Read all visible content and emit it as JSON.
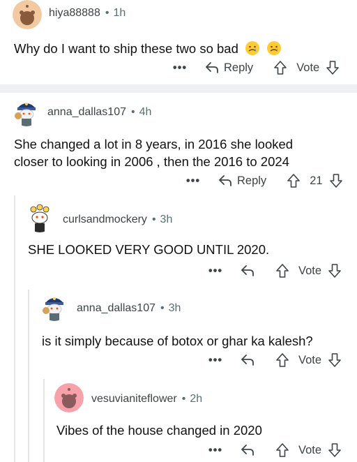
{
  "comments": [
    {
      "username": "hiya88888",
      "age": "1h",
      "text_lines": [
        "Why do I want to ship these two so bad"
      ],
      "emoji": [
        "crying-face",
        "crying-face"
      ],
      "reply_label": "Reply",
      "vote_label": "Vote",
      "avatar_color": "#f2c9a0"
    },
    {
      "username": "anna_dallas107",
      "age": "4h",
      "text_lines": [
        "She changed a lot in 8 years, in 2016 she looked",
        "closer to looking in 2006 , then the 2016 to 2024"
      ],
      "reply_label": "Reply",
      "vote_label": "21"
    },
    {
      "username": "curlsandmockery",
      "age": "3h",
      "text_lines": [
        "SHE LOOKED VERY GOOD UNTIL 2020."
      ],
      "vote_label": "Vote"
    },
    {
      "username": "anna_dallas107",
      "age": "3h",
      "text_lines": [
        "is it simply because of botox or ghar ka kalesh?"
      ],
      "vote_label": "Vote"
    },
    {
      "username": "vesuvianiteflower",
      "age": "2h",
      "text_lines": [
        "Vibes of the house changed in 2020"
      ],
      "vote_label": "Vote",
      "avatar_color": "#f7a1aa"
    }
  ],
  "more_label": "•••",
  "dot": "•",
  "colors": {
    "thread_line": "#e4e6e8",
    "meta_text": "#576f76",
    "divider": "#eef1f3"
  }
}
